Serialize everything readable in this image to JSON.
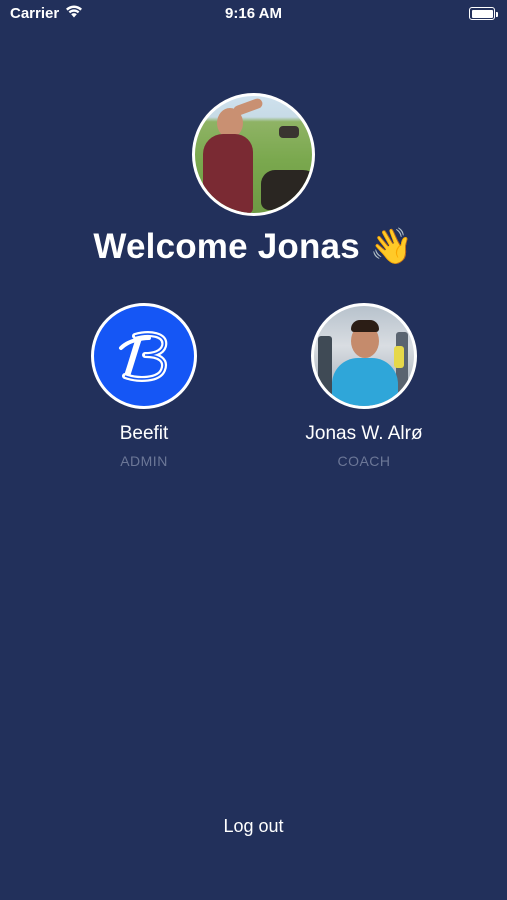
{
  "status_bar": {
    "carrier": "Carrier",
    "time": "9:16 AM"
  },
  "welcome": {
    "text": "Welcome Jonas",
    "emoji": "👋"
  },
  "accounts": [
    {
      "name": "Beefit",
      "role": "ADMIN",
      "avatar": "beefit-logo"
    },
    {
      "name": "Jonas W. Alrø",
      "role": "COACH",
      "avatar": "coach-photo"
    }
  ],
  "logout_label": "Log out",
  "colors": {
    "background": "#22305b",
    "brand_blue": "#1556f5",
    "role_text": "#6c7797",
    "text": "#ffffff"
  }
}
